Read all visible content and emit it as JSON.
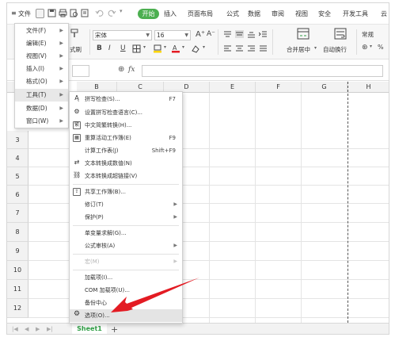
{
  "menubar": {
    "hamburger": "≡",
    "file": "文件",
    "start": "开始",
    "tabs": [
      "插入",
      "页面布局",
      "公式",
      "数据",
      "审阅",
      "视图",
      "安全",
      "开发工具",
      "云"
    ]
  },
  "toolbar": {
    "font_name": "宋体",
    "font_size": "16",
    "number_format": "常规",
    "format_brush": "式刷",
    "merge_center": "合并居中",
    "wrap_text": "自动换行",
    "bold": "B",
    "italic": "I",
    "underline": "U"
  },
  "formula_bar": {
    "fx": "fx",
    "zoom_icon": "⊕"
  },
  "columns": [
    "B",
    "C",
    "D",
    "E",
    "F",
    "G",
    "H"
  ],
  "rows": [
    "3",
    "4",
    "5",
    "6",
    "7",
    "8",
    "9",
    "10",
    "11",
    "12"
  ],
  "sheet": {
    "tab": "Sheet1",
    "add": "+"
  },
  "menu1": {
    "items": [
      {
        "label": "文件(F)"
      },
      {
        "label": "编辑(E)"
      },
      {
        "label": "视图(V)"
      },
      {
        "label": "插入(I)"
      },
      {
        "label": "格式(O)"
      },
      {
        "label": "工具(T)"
      },
      {
        "label": "数据(D)"
      },
      {
        "label": "窗口(W)"
      }
    ]
  },
  "menu2": {
    "items": [
      {
        "label": "拼写检查(S)...",
        "shortcut": "F7"
      },
      {
        "label": "设置拼写检查语言(C)..."
      },
      {
        "label": "中文简繁转换(H)..."
      },
      {
        "label": "重算活动工作簿(E)",
        "shortcut": "F9"
      },
      {
        "label": "计算工作表(J)",
        "shortcut": "Shift+F9"
      },
      {
        "label": "文本转换成数值(N)"
      },
      {
        "label": "文本转换成超链接(V)"
      },
      {
        "label": "共享工作簿(B)..."
      },
      {
        "label": "修订(T)"
      },
      {
        "label": "保护(P)"
      },
      {
        "label": "单变量求解(G)..."
      },
      {
        "label": "公式审核(A)"
      },
      {
        "label": "宏(M)"
      },
      {
        "label": "加载项(I)..."
      },
      {
        "label": "COM 加载项(U)..."
      },
      {
        "label": "备份中心"
      },
      {
        "label": "选项(O)..."
      }
    ]
  },
  "colors": {
    "accent": "#4caf50",
    "arrow": "#e31b23",
    "sheet_tab": "#2e9e44"
  }
}
